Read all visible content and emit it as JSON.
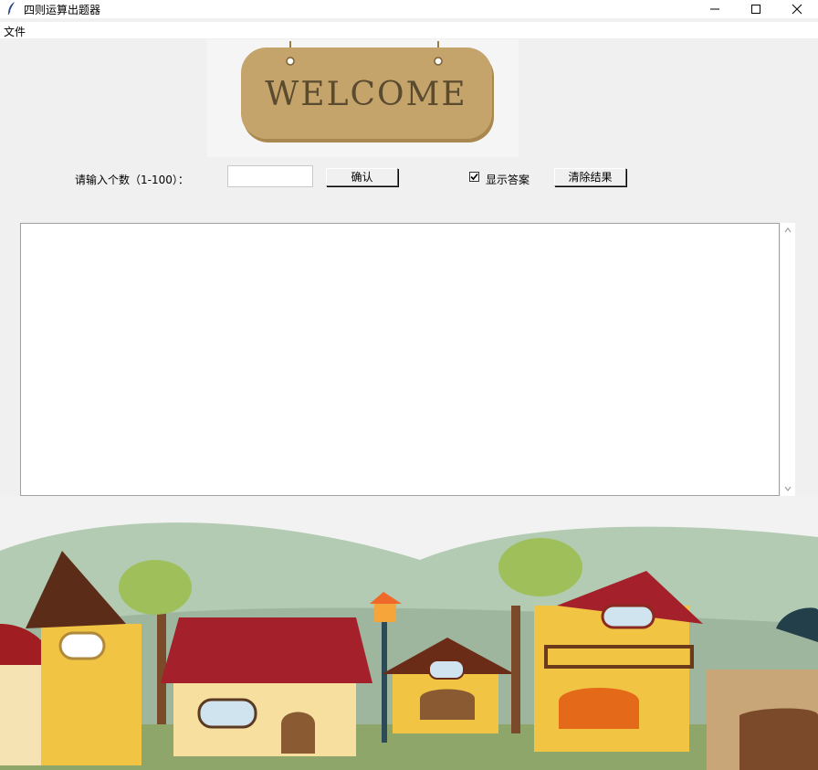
{
  "window": {
    "title": "四则运算出题器",
    "icon": "feather-icon"
  },
  "menu": {
    "file_label": "文件"
  },
  "banner": {
    "text": "WELCOME"
  },
  "form": {
    "count_label": "请输入个数（1-100）：",
    "count_value": "",
    "confirm_label": "确认",
    "show_answer_label": "显示答案",
    "show_answer_checked": true,
    "clear_label": "清除结果"
  },
  "results": {
    "text": ""
  },
  "colors": {
    "sign": "#c4a46a",
    "sign_text": "#5a4a30",
    "window_bg": "#f0f0f0",
    "sky": "#f2f2f2",
    "hills": "#b2cbb2"
  }
}
